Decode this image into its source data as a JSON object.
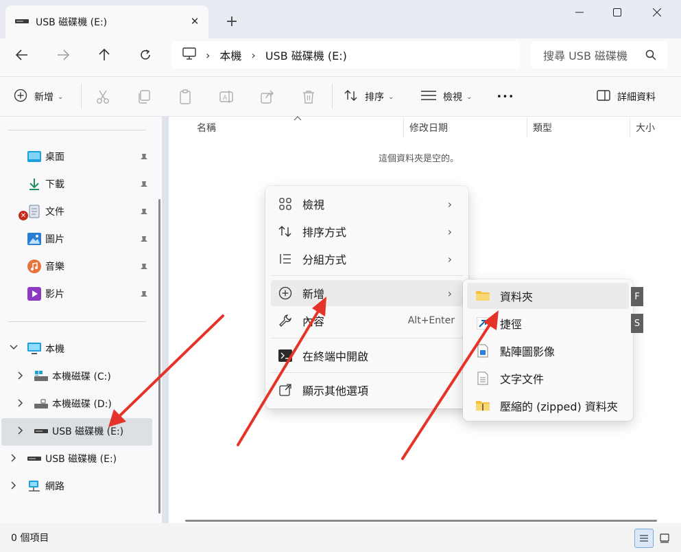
{
  "window": {
    "tab_title": "USB 磁碟機 (E:)",
    "tab_close_glyph": "✕",
    "new_tab_glyph": "+"
  },
  "address": {
    "crumb_root": "本機",
    "crumb_drive": "USB 磁碟機 (E:)",
    "search_placeholder": "搜尋 USB 磁碟機"
  },
  "toolbar": {
    "new_label": "新增",
    "sort_label": "排序",
    "view_label": "檢視",
    "more_label": "•••",
    "details_label": "詳細資料"
  },
  "sidebar": {
    "quick_access": [
      {
        "label": "桌面",
        "icon": "desktop-icon"
      },
      {
        "label": "下載",
        "icon": "download-icon"
      },
      {
        "label": "文件",
        "icon": "documents-icon"
      },
      {
        "label": "圖片",
        "icon": "pictures-icon"
      },
      {
        "label": "音樂",
        "icon": "music-icon"
      },
      {
        "label": "影片",
        "icon": "videos-icon"
      }
    ],
    "this_pc": "本機",
    "drives": [
      {
        "label": "本機磁碟 (C:)"
      },
      {
        "label": "本機磁碟 (D:)"
      },
      {
        "label": "USB 磁碟機 (E:)"
      }
    ],
    "usb_root": "USB 磁碟機 (E:)",
    "network": "網路"
  },
  "columns": {
    "name": "名稱",
    "modified": "修改日期",
    "type": "類型",
    "size": "大小"
  },
  "content": {
    "empty_message": "這個資料夾是空的。"
  },
  "status": {
    "items": "0 個項目"
  },
  "context_menu": {
    "view": "檢視",
    "sort": "排序方式",
    "group": "分組方式",
    "new": "新增",
    "properties": "內容",
    "properties_shortcut": "Alt+Enter",
    "open_terminal": "在終端中開啟",
    "more_options": "顯示其他選項",
    "chevron": "›"
  },
  "submenu": {
    "folder": "資料夾",
    "shortcut": "捷徑",
    "bitmap": "點陣圖影像",
    "text": "文字文件",
    "zipped": "壓縮的 (zipped) 資料夾",
    "key_folder": "F",
    "key_shortcut": "S"
  },
  "colors": {
    "annotation_arrow": "#e5332a",
    "selection": "#dcdfe4",
    "accent": "#0067c0"
  }
}
